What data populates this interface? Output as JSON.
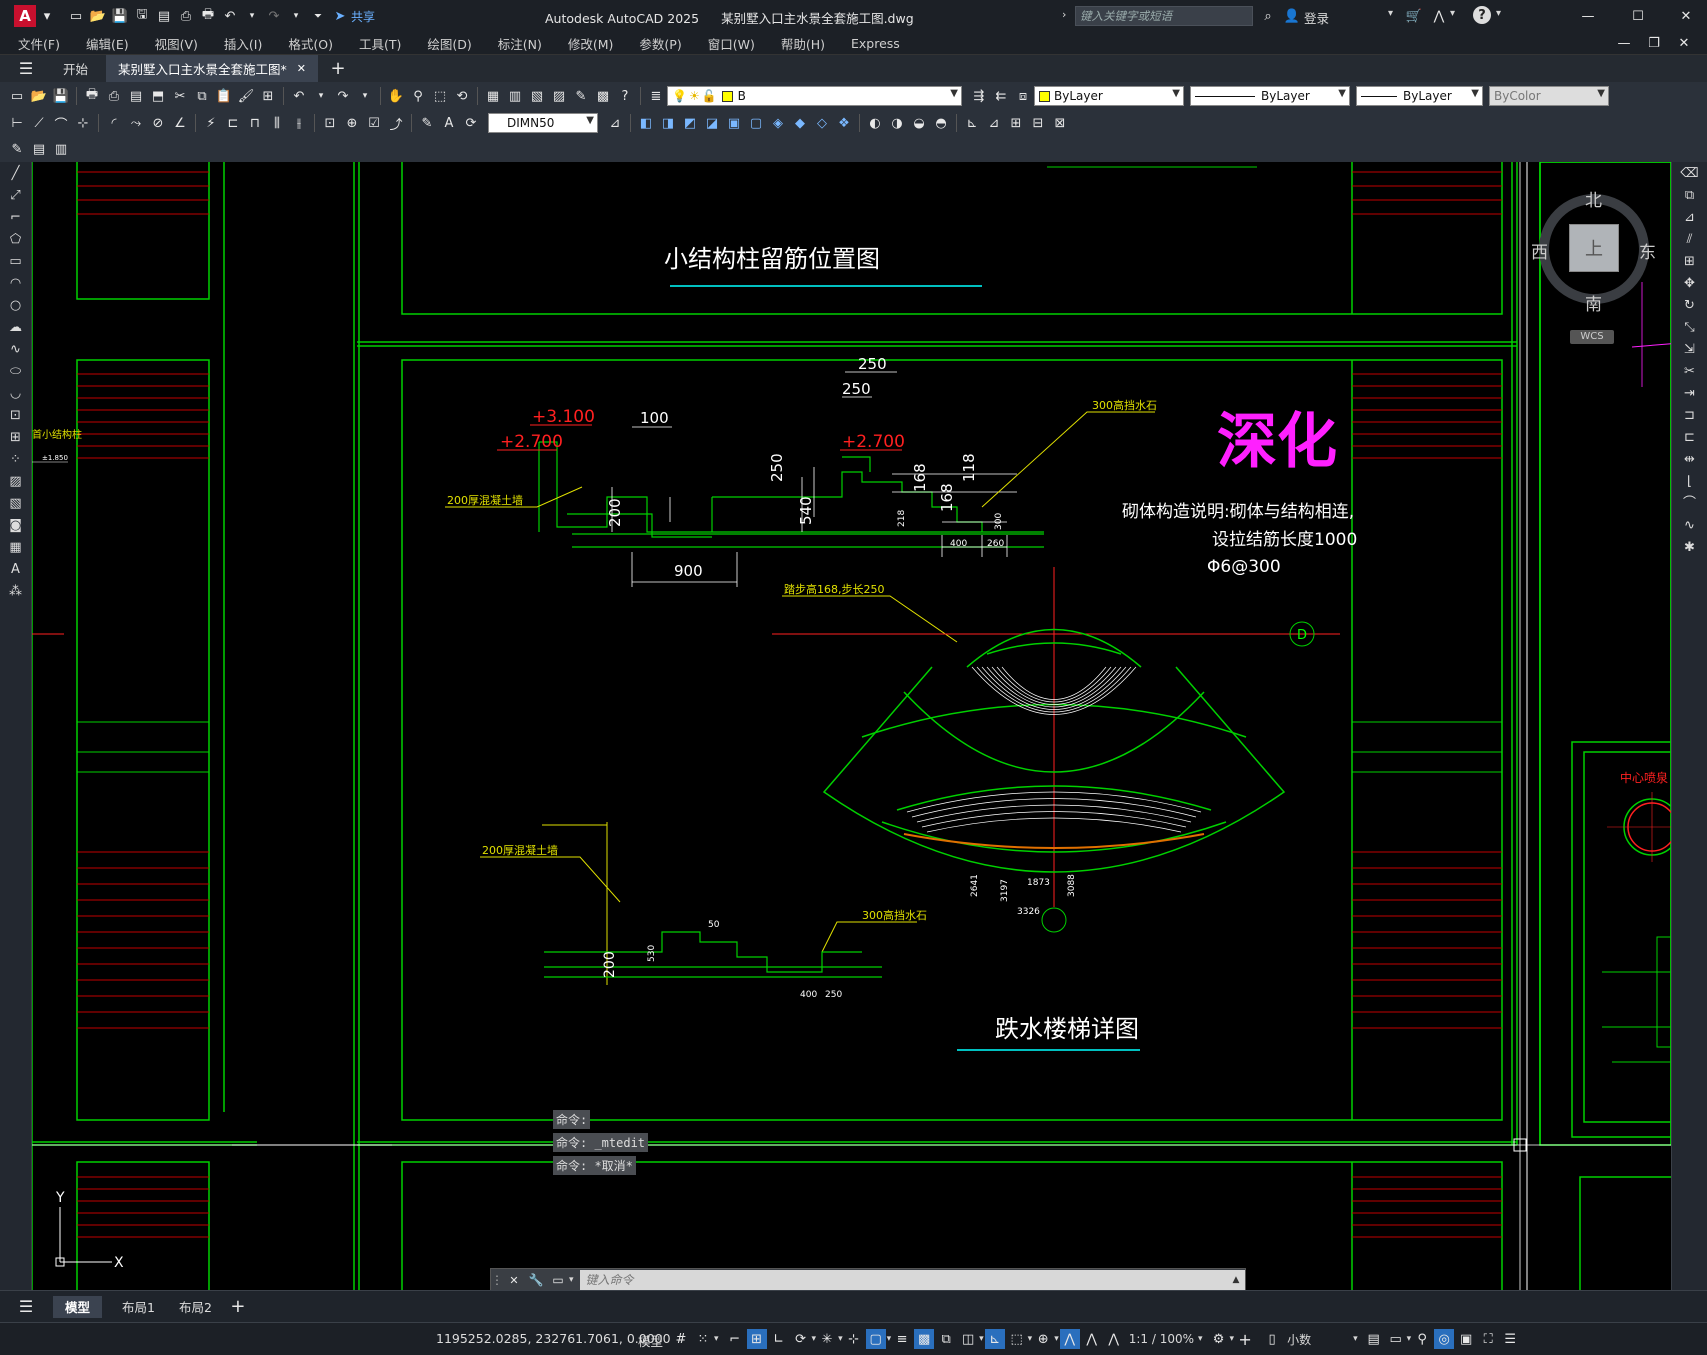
{
  "app": {
    "title": "Autodesk AutoCAD 2025",
    "filename": "某别墅入口主水景全套施工图.dwg",
    "search_placeholder": "键入关键字或短语",
    "login": "登录",
    "share": "共享",
    "logo": "A"
  },
  "menu": [
    "文件(F)",
    "编辑(E)",
    "视图(V)",
    "插入(I)",
    "格式(O)",
    "工具(T)",
    "绘图(D)",
    "标注(N)",
    "修改(M)",
    "参数(P)",
    "窗口(W)",
    "帮助(H)",
    "Express"
  ],
  "tabs": {
    "start": "开始",
    "doc": "某别墅入口主水景全套施工图*"
  },
  "toolbar": {
    "layer": "B",
    "color": "ByLayer",
    "linetype": "ByLayer",
    "lineweight": "ByLayer",
    "plotstyle": "ByColor",
    "dimstyle": "DIMN50"
  },
  "drawing": {
    "title_top": "小结构柱留筋位置图",
    "title_main": "跌水楼梯详图",
    "deepen": "深化",
    "note1": "砌体构造说明:砌体与结构相连,",
    "note2": "设拉结筋长度1000",
    "note3": "Φ6@300",
    "elev_3100": "+3.100",
    "elev_2700a": "+2.700",
    "elev_2700b": "+2.700",
    "dims": {
      "d250a": "250",
      "d250b": "250",
      "d100": "100",
      "d250c": "250",
      "d540": "540",
      "d200a": "200",
      "d900": "900",
      "d168a": "168",
      "d168b": "168",
      "d118": "118",
      "d400a": "400",
      "d260": "260",
      "d300a": "300",
      "d218": "218",
      "d200b": "200",
      "d400b": "400",
      "d250d": "250",
      "d50": "50",
      "d530": "530",
      "d1873": "1873",
      "d3326": "3326",
      "d3197": "3197",
      "d2641": "2641",
      "d3088": "3088"
    },
    "label_wall1": "200厚混凝土墙",
    "label_wall2": "200厚混凝土墙",
    "label_stone1": "300高挡水石",
    "label_stone2": "300高挡水石",
    "label_step": "踏步高168,步长250",
    "axis_d": "D",
    "side_label": "首小结构柱",
    "right_detail_title": "中心喷泉",
    "elev_left_small": "±1.850"
  },
  "viewcube": {
    "n": "北",
    "s": "南",
    "w": "西",
    "e": "东",
    "top": "上",
    "wcs": "WCS"
  },
  "ucs": {
    "y": "Y",
    "x": "X"
  },
  "commands": {
    "h1": "命令:",
    "h2": "命令: _mtedit",
    "h3": "命令: *取消*",
    "placeholder": "键入命令"
  },
  "layout_tabs": [
    "模型",
    "布局1",
    "布局2"
  ],
  "status": {
    "coords": "1195252.0285, 232761.7061, 0.0000",
    "model": "模型",
    "scale": "1:1 / 100%",
    "units": "小数"
  }
}
